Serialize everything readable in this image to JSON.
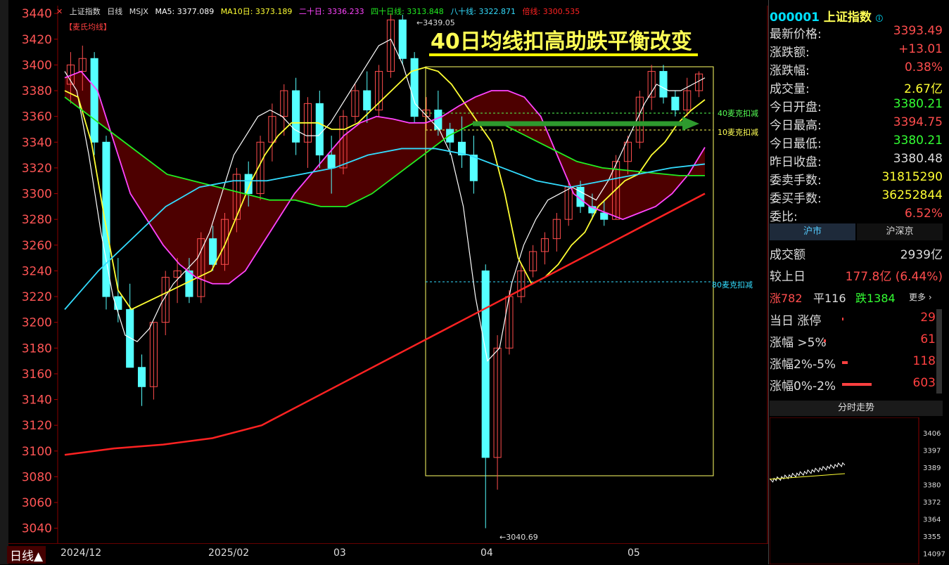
{
  "chart": {
    "legend": {
      "name": "上证指数",
      "period": "日线",
      "indicator": "MSJX",
      "ma5": "MA5: 3377.089",
      "ma10": "MA10日: 3373.189",
      "ma20": "二十日: 3336.233",
      "ma40": "四十日线: 3313.848",
      "ma80": "八十线: 3322.871",
      "ma250": "倍线: 3300.535"
    },
    "ma_tag": "【麦氏均线】",
    "annotation": "40日均线扣高助跌平衡改变",
    "labels": {
      "high_price": "3439.05",
      "low_price": "3040.69",
      "deduct40": "40麦克扣减",
      "deduct10": "10麦克扣减",
      "deduct80": "80麦克扣减"
    },
    "y_ticks": [
      "3440",
      "3420",
      "3400",
      "3380",
      "3360",
      "3340",
      "3320",
      "3300",
      "3280",
      "3260",
      "3240",
      "3220",
      "3200",
      "3180",
      "3160",
      "3140",
      "3120",
      "3100",
      "3080",
      "3060",
      "3040"
    ],
    "x_labels": [
      "2024/12",
      "2025/02",
      "03",
      "04",
      "05"
    ],
    "period_button": "日线▲",
    "colors": {
      "up": "#ff4d4d",
      "down": "#55ffff",
      "ma5": "#ffffff",
      "ma10": "#ffff33",
      "ma20": "#ff44ff",
      "ma40": "#22ee22",
      "ma80": "#33ddff",
      "ma250": "#ff2222",
      "fill_up": "#5a0000",
      "fill_down": "#0a0f5a"
    }
  },
  "chart_data": {
    "type": "candlestick",
    "y_range": [
      3030,
      3445
    ],
    "candles_ohlc_approx": [
      [
        3385,
        3410,
        3370,
        3400
      ],
      [
        3395,
        3415,
        3380,
        3405
      ],
      [
        3405,
        3410,
        3330,
        3340
      ],
      [
        3340,
        3345,
        3210,
        3220
      ],
      [
        3220,
        3250,
        3200,
        3210
      ],
      [
        3210,
        3230,
        3175,
        3165
      ],
      [
        3165,
        3175,
        3135,
        3150
      ],
      [
        3150,
        3200,
        3140,
        3200
      ],
      [
        3200,
        3240,
        3190,
        3235
      ],
      [
        3235,
        3250,
        3215,
        3240
      ],
      [
        3240,
        3250,
        3215,
        3220
      ],
      [
        3220,
        3270,
        3215,
        3265
      ],
      [
        3265,
        3275,
        3240,
        3245
      ],
      [
        3245,
        3285,
        3240,
        3280
      ],
      [
        3280,
        3320,
        3270,
        3315
      ],
      [
        3315,
        3325,
        3290,
        3300
      ],
      [
        3300,
        3345,
        3295,
        3340
      ],
      [
        3340,
        3370,
        3325,
        3360
      ],
      [
        3360,
        3385,
        3345,
        3380
      ],
      [
        3380,
        3390,
        3330,
        3340
      ],
      [
        3340,
        3375,
        3320,
        3370
      ],
      [
        3370,
        3380,
        3320,
        3330
      ],
      [
        3330,
        3345,
        3300,
        3320
      ],
      [
        3320,
        3365,
        3315,
        3360
      ],
      [
        3360,
        3385,
        3355,
        3380
      ],
      [
        3380,
        3395,
        3355,
        3365
      ],
      [
        3365,
        3400,
        3360,
        3395
      ],
      [
        3395,
        3440,
        3390,
        3435
      ],
      [
        3435,
        3439,
        3400,
        3405
      ],
      [
        3405,
        3410,
        3355,
        3360
      ],
      [
        3360,
        3375,
        3350,
        3365
      ],
      [
        3365,
        3380,
        3345,
        3350
      ],
      [
        3350,
        3355,
        3330,
        3340
      ],
      [
        3340,
        3360,
        3320,
        3330
      ],
      [
        3330,
        3345,
        3300,
        3310
      ],
      [
        3240,
        3245,
        3040,
        3095
      ],
      [
        3095,
        3190,
        3070,
        3180
      ],
      [
        3180,
        3225,
        3175,
        3220
      ],
      [
        3220,
        3245,
        3215,
        3240
      ],
      [
        3240,
        3260,
        3235,
        3255
      ],
      [
        3255,
        3270,
        3245,
        3265
      ],
      [
        3265,
        3285,
        3255,
        3280
      ],
      [
        3280,
        3310,
        3275,
        3305
      ],
      [
        3305,
        3310,
        3285,
        3290
      ],
      [
        3290,
        3300,
        3280,
        3285
      ],
      [
        3285,
        3295,
        3275,
        3280
      ],
      [
        3280,
        3330,
        3280,
        3325
      ],
      [
        3325,
        3345,
        3315,
        3340
      ],
      [
        3340,
        3380,
        3335,
        3375
      ],
      [
        3375,
        3400,
        3365,
        3395
      ],
      [
        3395,
        3400,
        3370,
        3375
      ],
      [
        3375,
        3380,
        3360,
        3365
      ],
      [
        3365,
        3390,
        3360,
        3380
      ],
      [
        3380,
        3395,
        3375,
        3393
      ]
    ],
    "series": [
      {
        "name": "MA5",
        "values": [
          3395,
          3380,
          3330,
          3270,
          3220,
          3190,
          3185,
          3195,
          3215,
          3230,
          3240,
          3250,
          3270,
          3300,
          3330,
          3345,
          3360,
          3365,
          3360,
          3350,
          3345,
          3345,
          3355,
          3370,
          3385,
          3400,
          3415,
          3420,
          3400,
          3370,
          3360,
          3350,
          3330,
          3290,
          3220,
          3170,
          3180,
          3230,
          3260,
          3280,
          3295,
          3300,
          3305,
          3300,
          3295,
          3310,
          3330,
          3350,
          3370,
          3385,
          3380,
          3380,
          3385,
          3390
        ]
      },
      {
        "name": "MA10",
        "values": [
          3380,
          3375,
          3340,
          3280,
          3225,
          3210,
          3215,
          3220,
          3225,
          3230,
          3235,
          3240,
          3260,
          3285,
          3310,
          3330,
          3345,
          3355,
          3355,
          3355,
          3350,
          3350,
          3355,
          3365,
          3375,
          3385,
          3395,
          3398,
          3395,
          3385,
          3370,
          3355,
          3340,
          3300,
          3250,
          3230,
          3235,
          3245,
          3260,
          3270,
          3290,
          3300,
          3310,
          3315,
          3330,
          3340,
          3355,
          3365,
          3373
        ]
      },
      {
        "name": "二十日",
        "values": [
          3390,
          3395,
          3380,
          3340,
          3300,
          3280,
          3260,
          3245,
          3235,
          3230,
          3230,
          3240,
          3260,
          3280,
          3300,
          3315,
          3330,
          3345,
          3355,
          3360,
          3358,
          3355,
          3355,
          3360,
          3368,
          3375,
          3380,
          3380,
          3375,
          3360,
          3330,
          3300,
          3290,
          3285,
          3280,
          3285,
          3290,
          3300,
          3315,
          3336
        ]
      },
      {
        "name": "四十日线",
        "values": [
          3375,
          3360,
          3345,
          3330,
          3315,
          3310,
          3305,
          3300,
          3295,
          3295,
          3290,
          3290,
          3300,
          3315,
          3330,
          3345,
          3355,
          3355,
          3345,
          3335,
          3325,
          3320,
          3318,
          3316,
          3314,
          3314
        ]
      },
      {
        "name": "八十线",
        "values": [
          3210,
          3240,
          3265,
          3290,
          3305,
          3310,
          3310,
          3315,
          3320,
          3330,
          3335,
          3335,
          3330,
          3320,
          3310,
          3305,
          3310,
          3315,
          3320,
          3323
        ]
      },
      {
        "name": "倍线",
        "values": [
          3097,
          3102,
          3105,
          3110,
          3120,
          3140,
          3160,
          3180,
          3200,
          3220,
          3240,
          3260,
          3280,
          3300
        ]
      }
    ]
  },
  "sidebar": {
    "code": "000001",
    "name": "上证指数",
    "quotes": [
      {
        "label": "最新价格:",
        "value": "3393.49",
        "color": "#ff4d4d"
      },
      {
        "label": "涨跌额:",
        "value": "+13.01",
        "color": "#ff4d4d"
      },
      {
        "label": "涨跌幅:",
        "value": "0.38%",
        "color": "#ff4d4d"
      },
      {
        "label": "成交量:",
        "value": "2.67亿",
        "color": "#ffff33"
      },
      {
        "label": "今日开盘:",
        "value": "3380.21",
        "color": "#33ff33"
      },
      {
        "label": "今日最高:",
        "value": "3394.75",
        "color": "#ff4d4d"
      },
      {
        "label": "今日最低:",
        "value": "3380.21",
        "color": "#33ff33"
      },
      {
        "label": "昨日收盘:",
        "value": "3380.48",
        "color": "#dddddd"
      },
      {
        "label": "委卖手数:",
        "value": "31815290",
        "color": "#ffff33"
      },
      {
        "label": "委买手数:",
        "value": "36252844",
        "color": "#ffff33"
      },
      {
        "label": "委比:",
        "value": "6.52%",
        "color": "#ff4d4d"
      }
    ],
    "tabs": [
      "沪市",
      "沪深京"
    ],
    "turnover_label": "成交额",
    "turnover_value": "2939亿",
    "vs_prev_label": "较上日",
    "vs_prev_value": "177.8亿 (6.44%)",
    "breadth": {
      "up": "涨782",
      "flat": "平116",
      "down": "跌1384",
      "more": "更多 ›"
    },
    "bars": [
      {
        "label": "当日 涨停",
        "value": "29",
        "fraction": 0.01
      },
      {
        "label": "涨幅 >5%",
        "value": "61",
        "fraction": 0.02
      },
      {
        "label": "涨幅2%-5%",
        "value": "118",
        "fraction": 0.06
      },
      {
        "label": "涨幅0%-2%",
        "value": "603",
        "fraction": 0.3
      }
    ],
    "mini_chart": {
      "title": "分时走势",
      "y_ticks": [
        "3406",
        "3397",
        "3389",
        "3380",
        "3372",
        "3364",
        "3355",
        "14097"
      ]
    }
  }
}
